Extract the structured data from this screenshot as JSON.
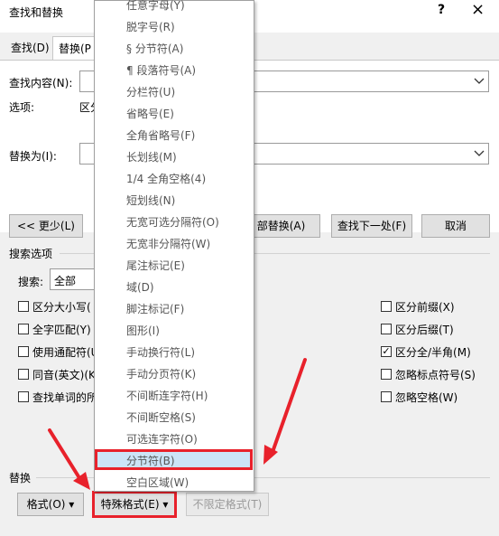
{
  "window": {
    "title": "查找和替换",
    "help": "?",
    "close": "×"
  },
  "tabs": {
    "find": "查找(D)",
    "replace": "替换(P"
  },
  "find": {
    "label": "查找内容(N):",
    "options_label": "选项:",
    "options_value": "区分"
  },
  "replace": {
    "label": "替换为(I):"
  },
  "buttons": {
    "less": "<< 更少(L)",
    "replace_all": "部替换(A)",
    "find_next": "查找下一处(F)",
    "cancel": "取消"
  },
  "search_options": {
    "heading": "搜索选项",
    "search_label": "搜索:",
    "search_value": "全部",
    "left": [
      "区分大小写(",
      "全字匹配(Y)",
      "使用通配符(U",
      "同音(英文)(K",
      "查找单词的所"
    ],
    "right": [
      "区分前缀(X)",
      "区分后缀(T)",
      "区分全/半角(M)",
      "忽略标点符号(S)",
      "忽略空格(W)"
    ],
    "right_checked": [
      false,
      false,
      true,
      false,
      false
    ]
  },
  "replace_section": {
    "heading": "替换",
    "format": "格式(O) ▾",
    "special": "特殊格式(E) ▾",
    "no_format": "不限定格式(T)"
  },
  "menu": {
    "items": [
      "任意字母(Y)",
      "脱字号(R)",
      "§ 分节符(A)",
      "¶ 段落符号(A)",
      "分栏符(U)",
      "省略号(E)",
      "全角省略号(F)",
      "长划线(M)",
      "1/4 全角空格(4)",
      "短划线(N)",
      "无宽可选分隔符(O)",
      "无宽非分隔符(W)",
      "尾注标记(E)",
      "域(D)",
      "脚注标记(F)",
      "图形(I)",
      "手动换行符(L)",
      "手动分页符(K)",
      "不间断连字符(H)",
      "不间断空格(S)",
      "可选连字符(O)",
      "分节符(B)",
      "空白区域(W)"
    ],
    "highlighted": "分节符(B)"
  },
  "colors": {
    "highlight_border": "#e8212b",
    "highlight_fill": "#cce4f7"
  }
}
